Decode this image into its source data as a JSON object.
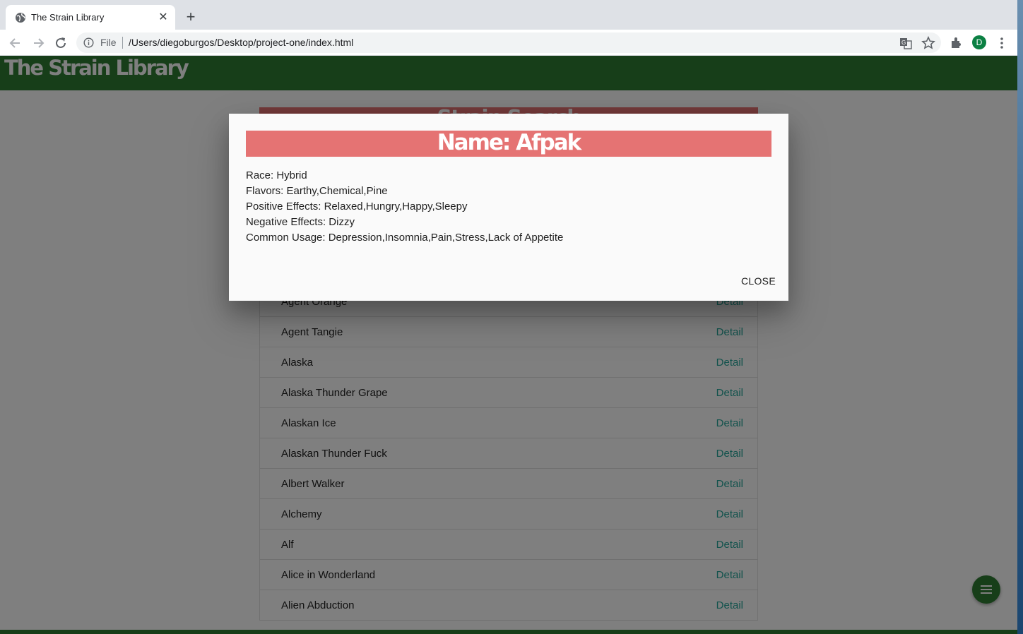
{
  "browser": {
    "tab_title": "The Strain Library",
    "tab_close": "✕",
    "new_tab": "+",
    "file_label": "File",
    "url": "/Users/diegoburgos/Desktop/project-one/index.html",
    "profile_initial": "D"
  },
  "navbar": {
    "brand": "The Strain Library"
  },
  "search_card": {
    "title": "Strain Search"
  },
  "strains": [
    {
      "name": "Agent Orange",
      "action": "Detail"
    },
    {
      "name": "Agent Tangie",
      "action": "Detail"
    },
    {
      "name": "Alaska",
      "action": "Detail"
    },
    {
      "name": "Alaska Thunder Grape",
      "action": "Detail"
    },
    {
      "name": "Alaskan Ice",
      "action": "Detail"
    },
    {
      "name": "Alaskan Thunder Fuck",
      "action": "Detail"
    },
    {
      "name": "Albert Walker",
      "action": "Detail"
    },
    {
      "name": "Alchemy",
      "action": "Detail"
    },
    {
      "name": "Alf",
      "action": "Detail"
    },
    {
      "name": "Alice in Wonderland",
      "action": "Detail"
    },
    {
      "name": "Alien Abduction",
      "action": "Detail"
    }
  ],
  "modal": {
    "title": "Name: Afpak",
    "race": "Race: Hybrid",
    "flavors": "Flavors: Earthy,Chemical,Pine",
    "positive": "Positive Effects: Relaxed,Hungry,Happy,Sleepy",
    "negative": "Negative Effects: Dizzy",
    "usage": "Common Usage: Depression,Insomnia,Pain,Stress,Lack of Appetite",
    "close_label": "CLOSE"
  },
  "colors": {
    "navbar": "#2e7d32",
    "header_accent": "#e57373",
    "link": "#26a69a"
  },
  "icons": [
    "globe-icon",
    "back-icon",
    "forward-icon",
    "reload-icon",
    "info-icon",
    "translate-icon",
    "star-icon",
    "extensions-icon",
    "menu-dots-icon",
    "hamburger-icon"
  ]
}
